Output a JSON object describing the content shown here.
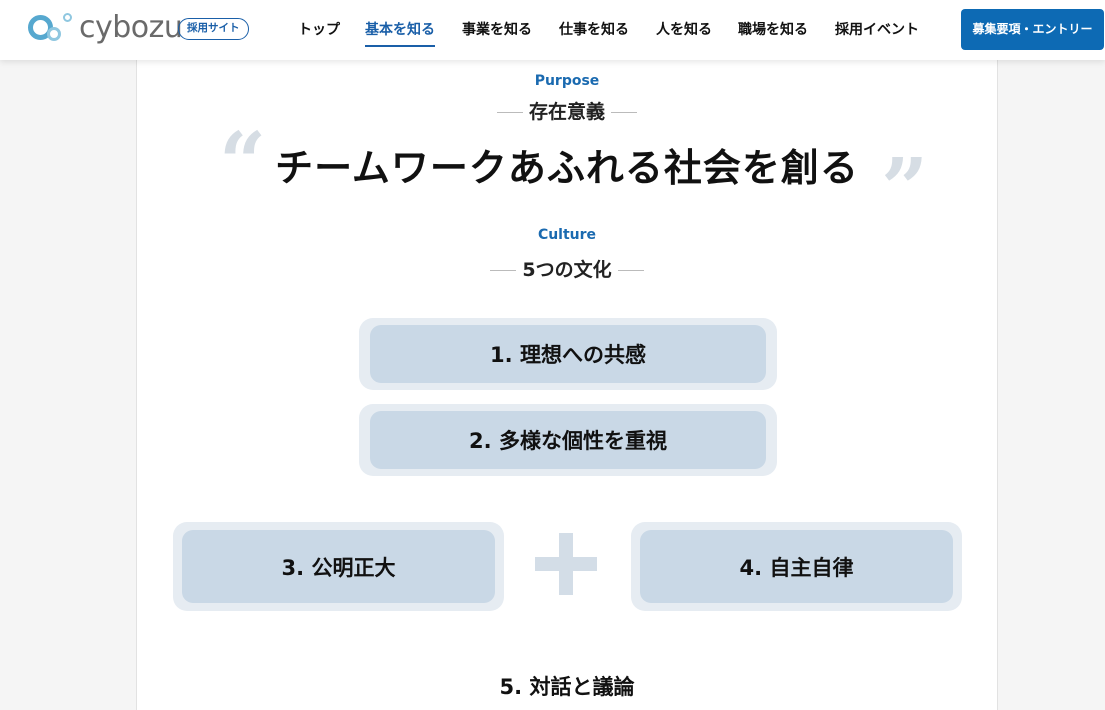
{
  "header": {
    "logo_text": "cybozu",
    "site_badge": "採用サイト",
    "nav": [
      {
        "label": "トップ",
        "active": false
      },
      {
        "label": "基本を知る",
        "active": true
      },
      {
        "label": "事業を知る",
        "active": false
      },
      {
        "label": "仕事を知る",
        "active": false
      },
      {
        "label": "人を知る",
        "active": false
      },
      {
        "label": "職場を知る",
        "active": false
      },
      {
        "label": "採用イベント",
        "active": false
      }
    ],
    "entry_button": "募集要項・エントリー"
  },
  "purpose": {
    "eyebrow": "Purpose",
    "title": "存在意義",
    "headline": "チームワークあふれる社会を創る",
    "open_quote": "“",
    "close_quote": "”"
  },
  "culture": {
    "eyebrow": "Culture",
    "title": "5つの文化",
    "items": [
      "1. 理想への共感",
      "2. 多様な個性を重視",
      "3. 公明正大",
      "4. 自主自律",
      "5. 対話と議論"
    ]
  },
  "colors": {
    "accent": "#1a5fa8",
    "entry_button": "#0d6ab4",
    "pill_outer": "#e6ecf2",
    "pill_inner": "#c9d8e6"
  }
}
